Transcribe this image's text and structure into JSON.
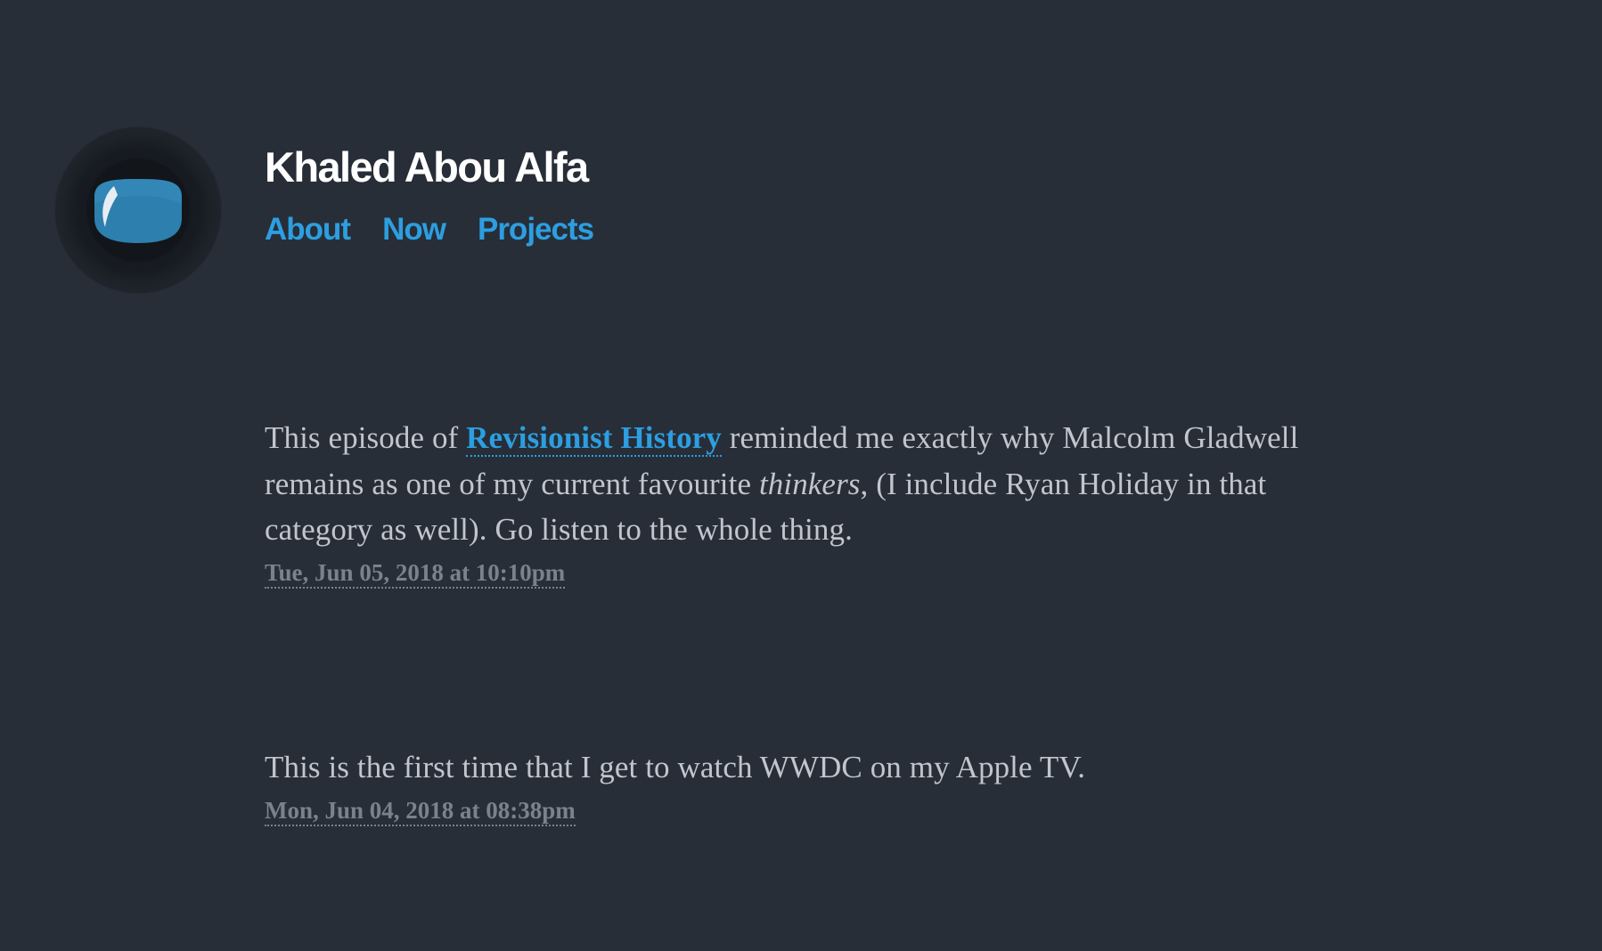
{
  "site": {
    "title": "Khaled Abou Alfa",
    "logo_icon": "eye-logo-icon"
  },
  "nav": {
    "items": [
      {
        "label": "About"
      },
      {
        "label": "Now"
      },
      {
        "label": "Projects"
      }
    ]
  },
  "posts": [
    {
      "text_before": "This episode of ",
      "link_text": "Revisionist History",
      "text_middle": " reminded me exactly why Malcolm Gladwell remains as one of my current favourite ",
      "emphasis": "thinkers",
      "text_after": ", (I include Ryan Holiday in that category as well). Go listen to the whole thing.",
      "date": "Tue, Jun 05, 2018 at 10:10pm"
    },
    {
      "text": "This is the first time that I get to watch WWDC on my Apple TV.",
      "date": "Mon, Jun 04, 2018 at 08:38pm"
    }
  ],
  "colors": {
    "background": "#272e38",
    "accent": "#2d9ee0",
    "text": "#c1c6cc",
    "muted": "#7a828c",
    "title": "#ffffff"
  }
}
